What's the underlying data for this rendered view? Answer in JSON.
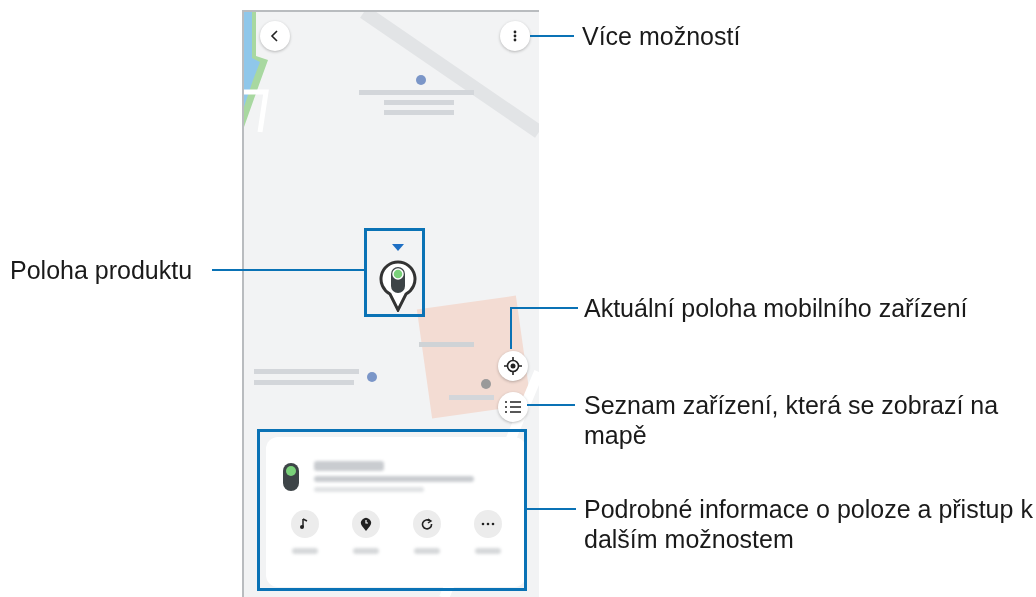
{
  "callouts": [
    {
      "kind": "more",
      "label": "Více možností"
    },
    {
      "kind": "product",
      "label": "Poloha produktu"
    },
    {
      "kind": "locate",
      "label": "Aktuální poloha mobilního zařízení"
    },
    {
      "kind": "list",
      "label": "Seznam zařízení, která se zobrazí na mapě"
    },
    {
      "kind": "card",
      "label": "Podrobné informace o poloze a přistup k dalším možnostem"
    }
  ]
}
